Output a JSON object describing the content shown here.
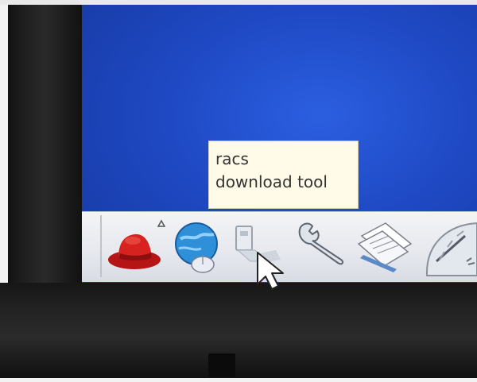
{
  "tooltip": {
    "line1": "racs",
    "line2": "download tool"
  },
  "panel": {
    "launchers": [
      {
        "icon": "redhat-hat-icon"
      },
      {
        "icon": "globe-mouse-icon"
      },
      {
        "icon": "download-tool-icon"
      },
      {
        "icon": "wrench-icon"
      },
      {
        "icon": "documents-icon"
      },
      {
        "icon": "gauge-icon"
      }
    ]
  },
  "colors": {
    "desktop": "#1f49c4",
    "tooltip_bg": "#fffbe8",
    "panel_bg": "#e6e8ee",
    "hat_red": "#d41f1f"
  }
}
